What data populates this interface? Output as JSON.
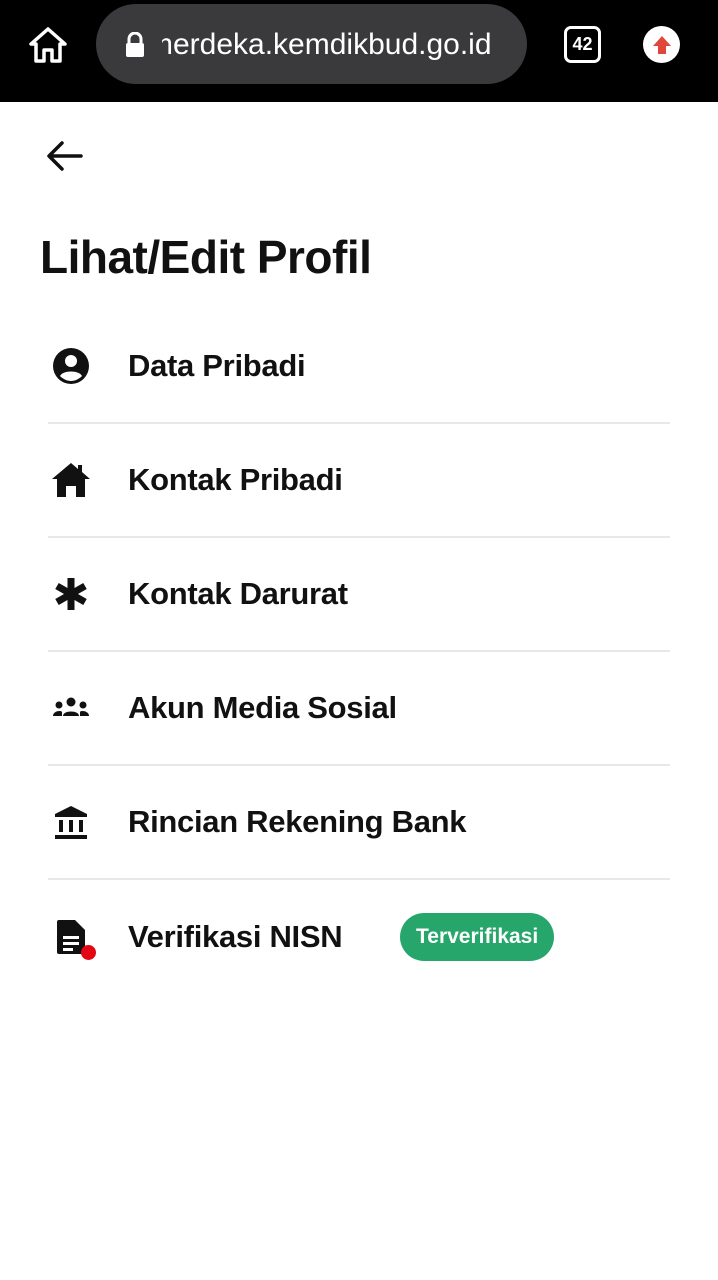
{
  "browser": {
    "url": "merdeka.kemdikbud.go.id",
    "tab_count": "42"
  },
  "page": {
    "title": "Lihat/Edit Profil"
  },
  "menu": {
    "items": [
      {
        "label": "Data Pribadi",
        "icon": "account-circle-icon"
      },
      {
        "label": "Kontak Pribadi",
        "icon": "home-icon"
      },
      {
        "label": "Kontak Darurat",
        "icon": "asterisk-icon"
      },
      {
        "label": "Akun Media Sosial",
        "icon": "groups-icon"
      },
      {
        "label": "Rincian Rekening Bank",
        "icon": "bank-icon"
      },
      {
        "label": "Verifikasi NISN",
        "icon": "document-icon",
        "badge": "Terverifikasi",
        "has_notification": true
      }
    ]
  },
  "colors": {
    "badge_bg": "#27a66b",
    "notification_dot": "#e30613",
    "browser_bar": "#000000",
    "url_pill": "#3a3a3c"
  }
}
